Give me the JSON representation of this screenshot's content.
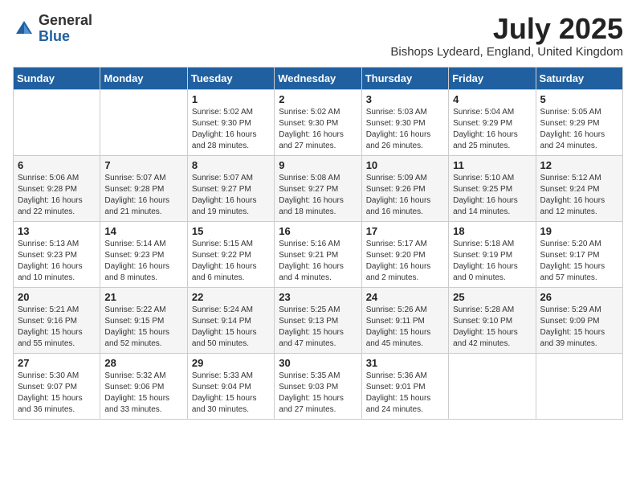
{
  "logo": {
    "general": "General",
    "blue": "Blue"
  },
  "title": "July 2025",
  "subtitle": "Bishops Lydeard, England, United Kingdom",
  "headers": [
    "Sunday",
    "Monday",
    "Tuesday",
    "Wednesday",
    "Thursday",
    "Friday",
    "Saturday"
  ],
  "weeks": [
    [
      {
        "day": "",
        "info": ""
      },
      {
        "day": "",
        "info": ""
      },
      {
        "day": "1",
        "info": "Sunrise: 5:02 AM\nSunset: 9:30 PM\nDaylight: 16 hours\nand 28 minutes."
      },
      {
        "day": "2",
        "info": "Sunrise: 5:02 AM\nSunset: 9:30 PM\nDaylight: 16 hours\nand 27 minutes."
      },
      {
        "day": "3",
        "info": "Sunrise: 5:03 AM\nSunset: 9:30 PM\nDaylight: 16 hours\nand 26 minutes."
      },
      {
        "day": "4",
        "info": "Sunrise: 5:04 AM\nSunset: 9:29 PM\nDaylight: 16 hours\nand 25 minutes."
      },
      {
        "day": "5",
        "info": "Sunrise: 5:05 AM\nSunset: 9:29 PM\nDaylight: 16 hours\nand 24 minutes."
      }
    ],
    [
      {
        "day": "6",
        "info": "Sunrise: 5:06 AM\nSunset: 9:28 PM\nDaylight: 16 hours\nand 22 minutes."
      },
      {
        "day": "7",
        "info": "Sunrise: 5:07 AM\nSunset: 9:28 PM\nDaylight: 16 hours\nand 21 minutes."
      },
      {
        "day": "8",
        "info": "Sunrise: 5:07 AM\nSunset: 9:27 PM\nDaylight: 16 hours\nand 19 minutes."
      },
      {
        "day": "9",
        "info": "Sunrise: 5:08 AM\nSunset: 9:27 PM\nDaylight: 16 hours\nand 18 minutes."
      },
      {
        "day": "10",
        "info": "Sunrise: 5:09 AM\nSunset: 9:26 PM\nDaylight: 16 hours\nand 16 minutes."
      },
      {
        "day": "11",
        "info": "Sunrise: 5:10 AM\nSunset: 9:25 PM\nDaylight: 16 hours\nand 14 minutes."
      },
      {
        "day": "12",
        "info": "Sunrise: 5:12 AM\nSunset: 9:24 PM\nDaylight: 16 hours\nand 12 minutes."
      }
    ],
    [
      {
        "day": "13",
        "info": "Sunrise: 5:13 AM\nSunset: 9:23 PM\nDaylight: 16 hours\nand 10 minutes."
      },
      {
        "day": "14",
        "info": "Sunrise: 5:14 AM\nSunset: 9:23 PM\nDaylight: 16 hours\nand 8 minutes."
      },
      {
        "day": "15",
        "info": "Sunrise: 5:15 AM\nSunset: 9:22 PM\nDaylight: 16 hours\nand 6 minutes."
      },
      {
        "day": "16",
        "info": "Sunrise: 5:16 AM\nSunset: 9:21 PM\nDaylight: 16 hours\nand 4 minutes."
      },
      {
        "day": "17",
        "info": "Sunrise: 5:17 AM\nSunset: 9:20 PM\nDaylight: 16 hours\nand 2 minutes."
      },
      {
        "day": "18",
        "info": "Sunrise: 5:18 AM\nSunset: 9:19 PM\nDaylight: 16 hours\nand 0 minutes."
      },
      {
        "day": "19",
        "info": "Sunrise: 5:20 AM\nSunset: 9:17 PM\nDaylight: 15 hours\nand 57 minutes."
      }
    ],
    [
      {
        "day": "20",
        "info": "Sunrise: 5:21 AM\nSunset: 9:16 PM\nDaylight: 15 hours\nand 55 minutes."
      },
      {
        "day": "21",
        "info": "Sunrise: 5:22 AM\nSunset: 9:15 PM\nDaylight: 15 hours\nand 52 minutes."
      },
      {
        "day": "22",
        "info": "Sunrise: 5:24 AM\nSunset: 9:14 PM\nDaylight: 15 hours\nand 50 minutes."
      },
      {
        "day": "23",
        "info": "Sunrise: 5:25 AM\nSunset: 9:13 PM\nDaylight: 15 hours\nand 47 minutes."
      },
      {
        "day": "24",
        "info": "Sunrise: 5:26 AM\nSunset: 9:11 PM\nDaylight: 15 hours\nand 45 minutes."
      },
      {
        "day": "25",
        "info": "Sunrise: 5:28 AM\nSunset: 9:10 PM\nDaylight: 15 hours\nand 42 minutes."
      },
      {
        "day": "26",
        "info": "Sunrise: 5:29 AM\nSunset: 9:09 PM\nDaylight: 15 hours\nand 39 minutes."
      }
    ],
    [
      {
        "day": "27",
        "info": "Sunrise: 5:30 AM\nSunset: 9:07 PM\nDaylight: 15 hours\nand 36 minutes."
      },
      {
        "day": "28",
        "info": "Sunrise: 5:32 AM\nSunset: 9:06 PM\nDaylight: 15 hours\nand 33 minutes."
      },
      {
        "day": "29",
        "info": "Sunrise: 5:33 AM\nSunset: 9:04 PM\nDaylight: 15 hours\nand 30 minutes."
      },
      {
        "day": "30",
        "info": "Sunrise: 5:35 AM\nSunset: 9:03 PM\nDaylight: 15 hours\nand 27 minutes."
      },
      {
        "day": "31",
        "info": "Sunrise: 5:36 AM\nSunset: 9:01 PM\nDaylight: 15 hours\nand 24 minutes."
      },
      {
        "day": "",
        "info": ""
      },
      {
        "day": "",
        "info": ""
      }
    ]
  ]
}
